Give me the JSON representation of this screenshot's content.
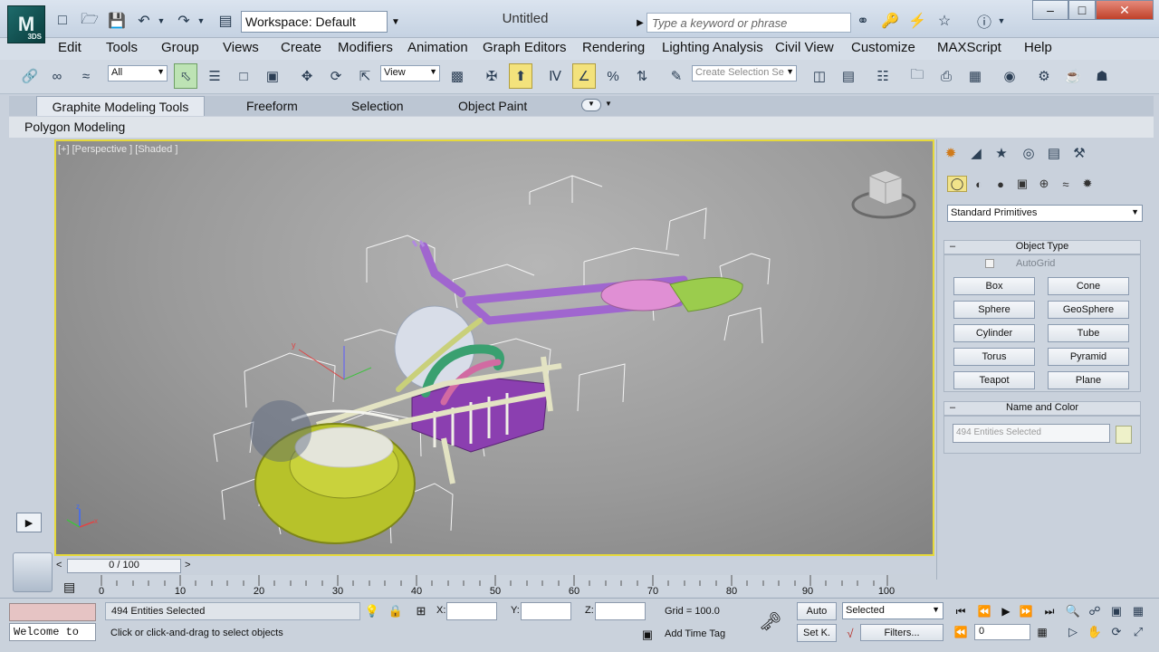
{
  "window": {
    "title": "Untitled",
    "workspace_value": "Workspace: Default",
    "search_placeholder": "Type a keyword or phrase",
    "logo_text": "M",
    "logo_sub": "3DS",
    "minimize": "–",
    "maximize": "□",
    "close": "✕"
  },
  "menu": [
    "Edit",
    "Tools",
    "Group",
    "Views",
    "Create",
    "Modifiers",
    "Animation",
    "Graph Editors",
    "Rendering",
    "Lighting Analysis",
    "Civil View",
    "Customize",
    "MAXScript",
    "Help"
  ],
  "toolbar": {
    "filter_value": "All",
    "refcoord_value": "View",
    "named_selection_placeholder": "Create Selection Se"
  },
  "ribbon": {
    "tabs": [
      "Graphite Modeling Tools",
      "Freeform",
      "Selection",
      "Object Paint"
    ],
    "panel_label": "Polygon Modeling"
  },
  "viewport": {
    "label": "[+] [Perspective ] [Shaded ]"
  },
  "command_panel": {
    "primitive_type": "Standard Primitives",
    "object_type_title": "Object Type",
    "autogrid_label": "AutoGrid",
    "buttons": [
      "Box",
      "Cone",
      "Sphere",
      "GeoSphere",
      "Cylinder",
      "Tube",
      "Torus",
      "Pyramid",
      "Teapot",
      "Plane"
    ],
    "name_color_title": "Name and Color",
    "name_value": "494 Entities Selected",
    "collapse_symbol": "–"
  },
  "timeline": {
    "slider_text": "0 / 100",
    "ticks": [
      "0",
      "10",
      "20",
      "30",
      "40",
      "50",
      "60",
      "70",
      "80",
      "90",
      "100"
    ],
    "left_arrow": "<",
    "right_arrow": ">"
  },
  "status": {
    "selection_text": "494 Entities Selected",
    "prompt_text": "Click or click-and-drag to select objects",
    "listener_text": "Welcome to",
    "x_label": "X:",
    "y_label": "Y:",
    "z_label": "Z:",
    "grid_text": "Grid = 100.0",
    "add_time_tag": "Add Time Tag",
    "auto_key": "Auto",
    "set_key": "Set K.",
    "selected_value": "Selected",
    "filters_label": "Filters...",
    "frame_value": "0"
  }
}
